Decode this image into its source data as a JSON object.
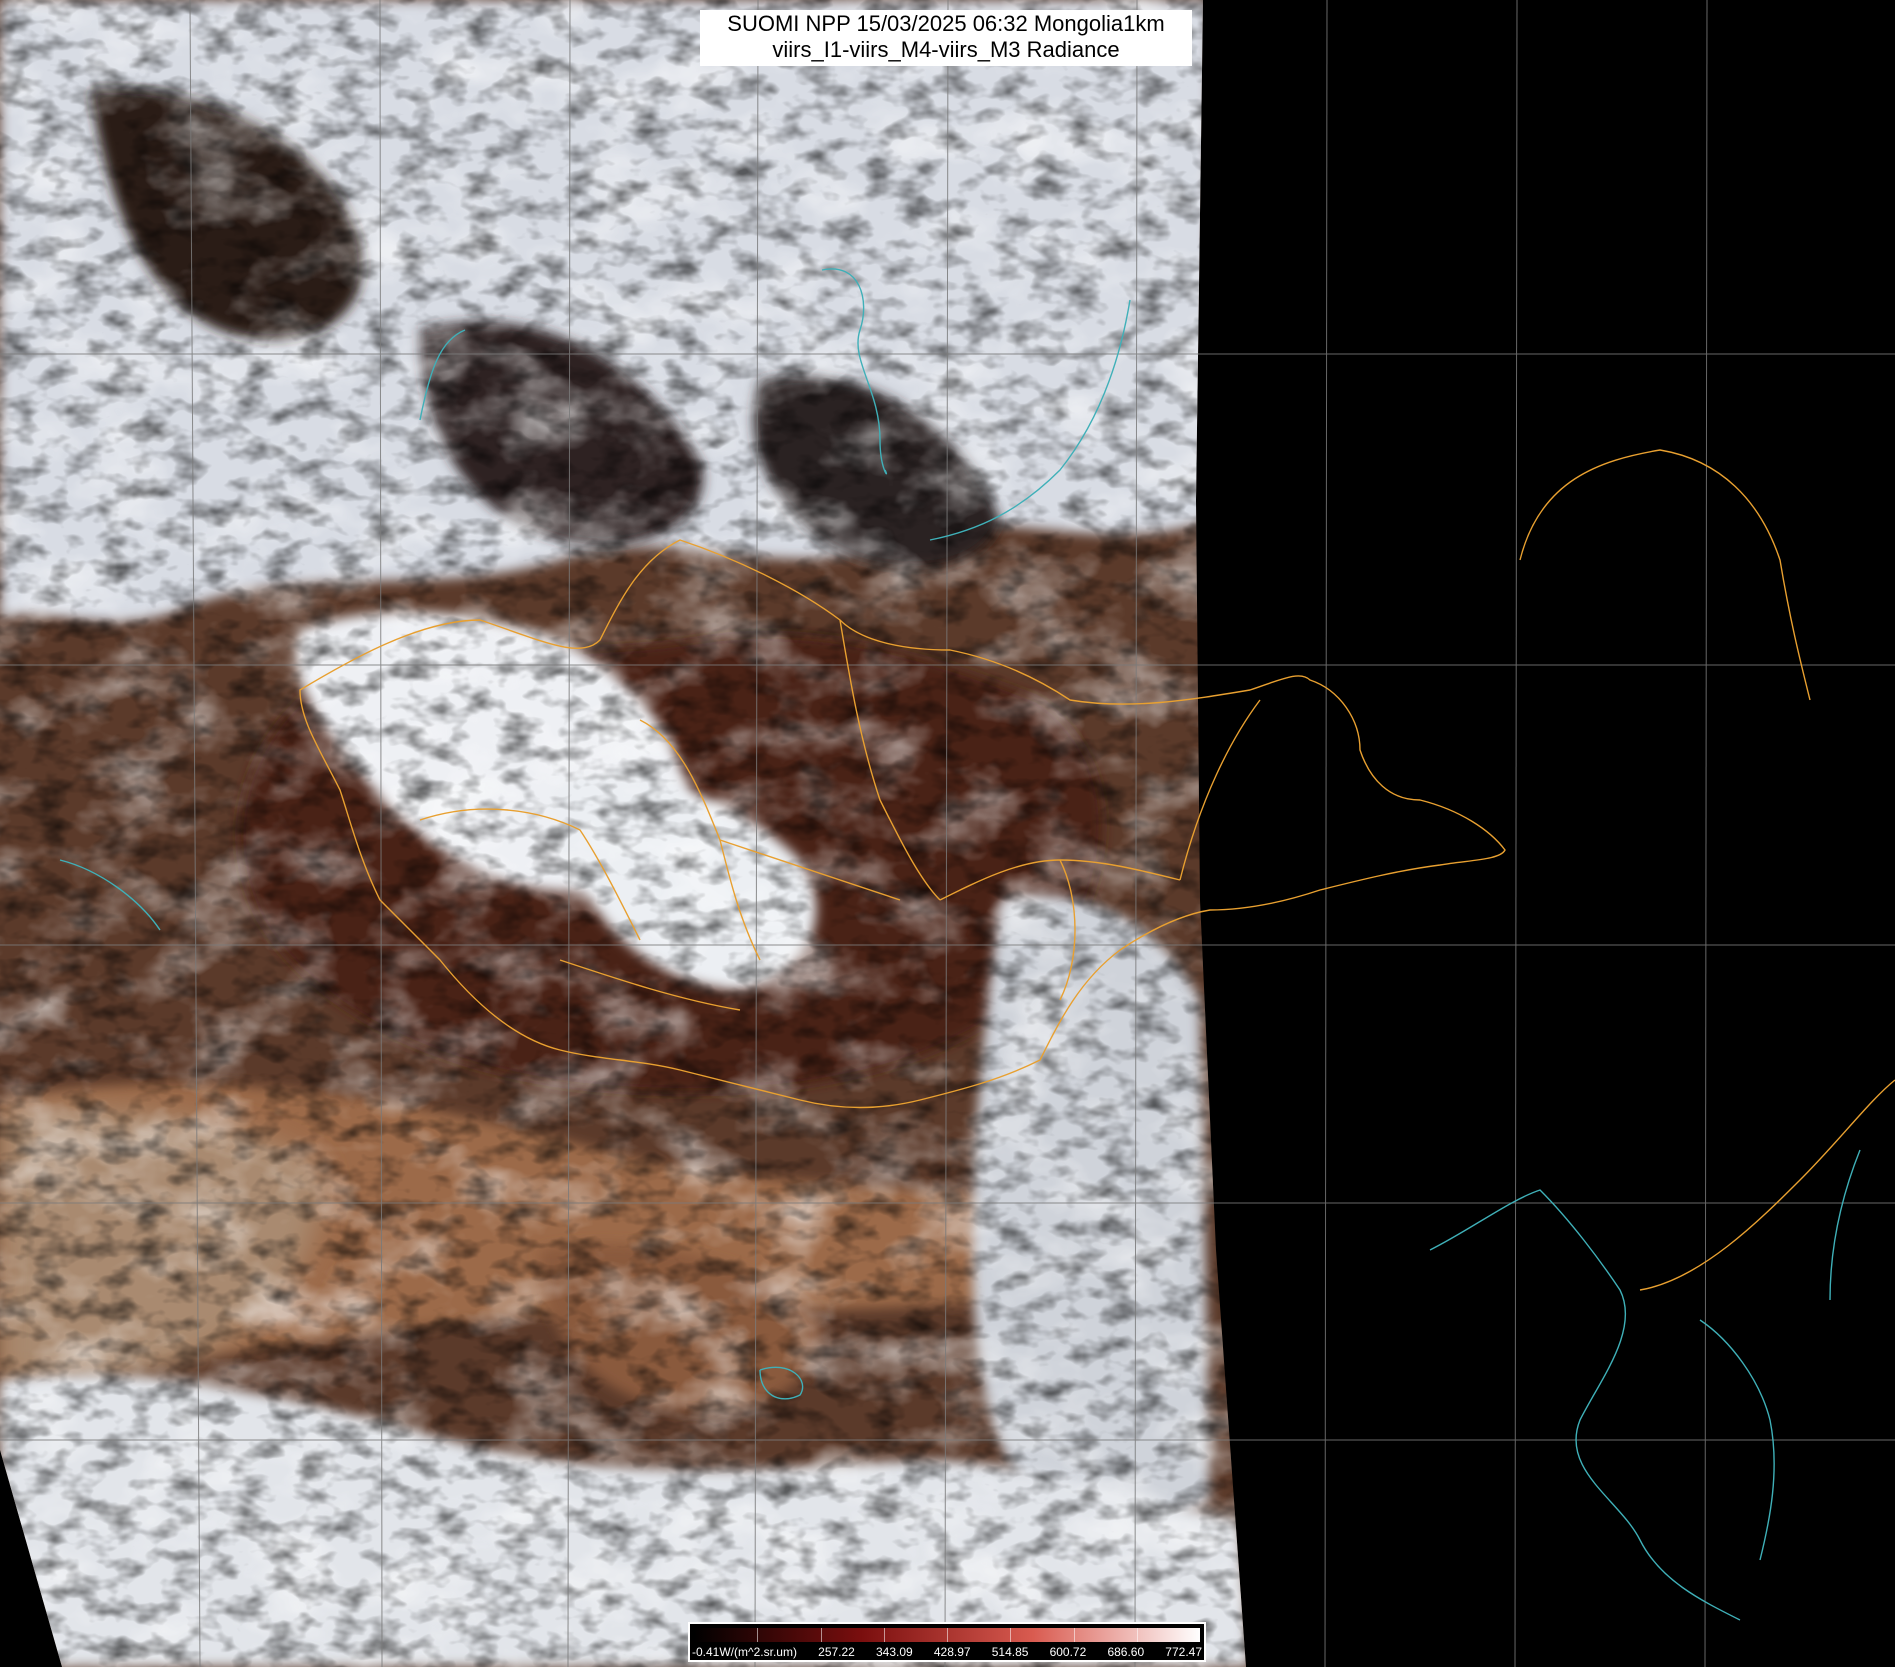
{
  "header": {
    "line1": "SUOMI NPP 15/03/2025 06:32 Mongolia1km",
    "line2": "viirs_I1-viirs_M4-viirs_M3 Radiance"
  },
  "legend": {
    "labels": [
      "-0.41W/(m^2.sr.um)",
      "257.22",
      "343.09",
      "428.97",
      "514.85",
      "600.72",
      "686.60",
      "772.47"
    ],
    "colors": [
      "#000000",
      "#7a0e0e",
      "#d95b50",
      "#ffffff"
    ]
  },
  "map": {
    "colors": {
      "border": "#e8a030",
      "coast": "#3fb0b8",
      "grid": "#7a7a7a",
      "nodata": "#000000",
      "cloud": "#dfe3ea",
      "desert": "#9c6a4a",
      "steppe": "#4a2418"
    }
  }
}
